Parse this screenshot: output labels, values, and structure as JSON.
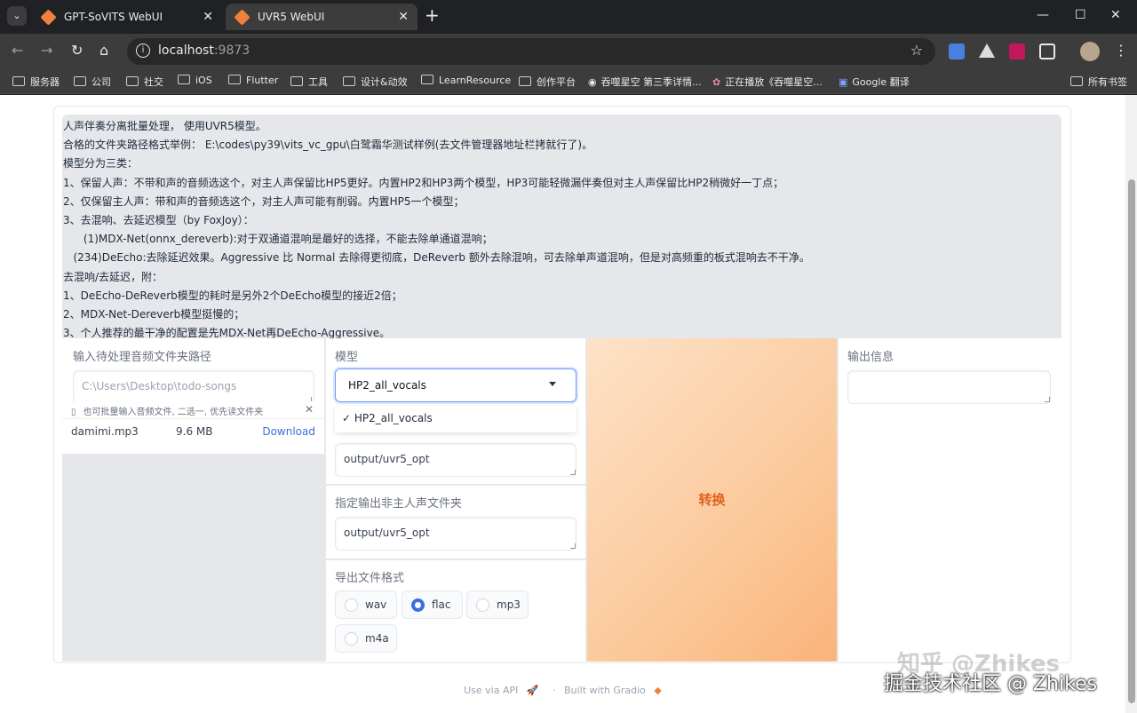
{
  "browser": {
    "tabs": [
      {
        "title": "GPT-SoVITS WebUI",
        "active": false
      },
      {
        "title": "UVR5 WebUI",
        "active": true
      }
    ],
    "url_host": "localhost",
    "url_port": ":9873",
    "bookmarks": [
      "服务器",
      "公司",
      "社交",
      "iOS",
      "Flutter",
      "工具",
      "设计&动效",
      "LearnResource",
      "创作平台",
      "吞噬星空 第三季详情...",
      "正在播放《吞噬星空...",
      "Google 翻译",
      "所有书签"
    ]
  },
  "intro": [
    "人声伴奏分离批量处理， 使用UVR5模型。",
    "合格的文件夹路径格式举例： E:\\codes\\py39\\vits_vc_gpu\\白鹭霜华测试样例(去文件管理器地址栏拷就行了)。",
    "模型分为三类：",
    "1、保留人声：不带和声的音频选这个，对主人声保留比HP5更好。内置HP2和HP3两个模型，HP3可能轻微漏伴奏但对主人声保留比HP2稍微好一丁点；",
    "2、仅保留主人声：带和声的音频选这个，对主人声可能有削弱。内置HP5一个模型；",
    "3、去混响、去延迟模型（by FoxJoy）：",
    "      (1)MDX-Net(onnx_dereverb):对于双通道混响是最好的选择，不能去除单通道混响；",
    "   (234)DeEcho:去除延迟效果。Aggressive 比 Normal 去除得更彻底，DeReverb 额外去除混响，可去除单声道混响，但是对高频重的板式混响去不干净。",
    "去混响/去延迟，附：",
    "1、DeEcho-DeReverb模型的耗时是另外2个DeEcho模型的接近2倍；",
    "2、MDX-Net-Dereverb模型挺慢的；",
    "3、个人推荐的最干净的配置是先MDX-Net再DeEcho-Aggressive。"
  ],
  "input_dir": {
    "label": "输入待处理音频文件夹路径",
    "placeholder": "C:\\Users\\Desktop\\todo-songs"
  },
  "file_upload": {
    "label": "也可批量输入音频文件, 二选一, 优先读文件夹",
    "file_name": "damimi.mp3",
    "file_size": "9.6 MB",
    "download": "Download"
  },
  "model": {
    "label": "模型",
    "selected": "HP2_all_vocals",
    "options": [
      "✓ HP2_all_vocals"
    ]
  },
  "vocal_out": {
    "value": "output/uvr5_opt"
  },
  "ins_out": {
    "label": "指定输出非主人声文件夹",
    "value": "output/uvr5_opt"
  },
  "format": {
    "label": "导出文件格式",
    "options": [
      {
        "label": "wav",
        "checked": false
      },
      {
        "label": "flac",
        "checked": true
      },
      {
        "label": "mp3",
        "checked": false
      },
      {
        "label": "m4a",
        "checked": false
      }
    ]
  },
  "convert_button": "转换",
  "output_info": {
    "label": "输出信息",
    "value": ""
  },
  "footer": {
    "api": "Use via API",
    "built": "Built with Gradio",
    "sep": "·"
  },
  "watermark": {
    "main": "知乎 @Zhikes",
    "sub": "掘金技术社区 @ Zhikes"
  }
}
